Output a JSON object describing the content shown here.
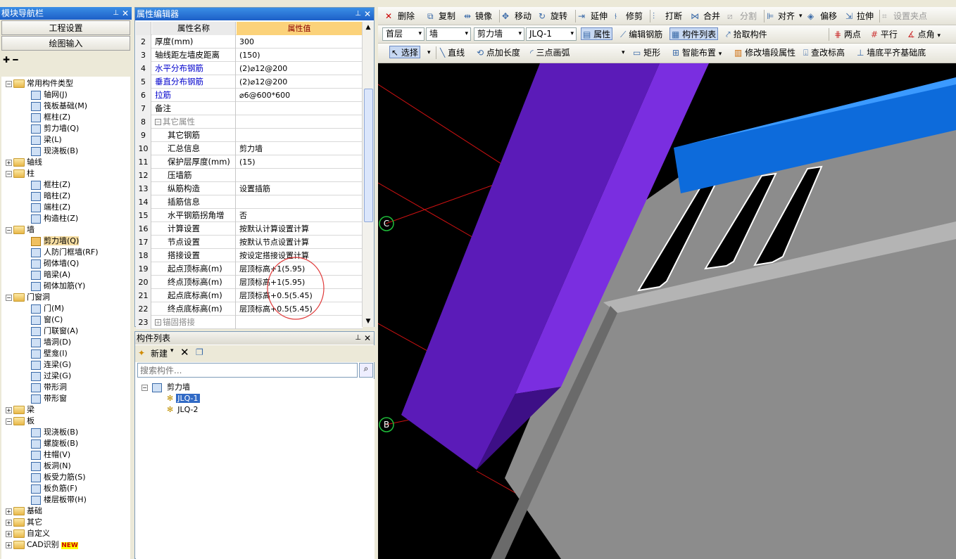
{
  "nav": {
    "title": "模块导航栏",
    "btn_project": "工程设置",
    "btn_draw": "绘图输入",
    "tools": "✚ ━",
    "tree": [
      {
        "lvl": 0,
        "exp": "-",
        "folder": true,
        "label": "常用构件类型"
      },
      {
        "lvl": 1,
        "label": "轴网(J)"
      },
      {
        "lvl": 1,
        "label": "筏板基础(M)"
      },
      {
        "lvl": 1,
        "label": "框柱(Z)"
      },
      {
        "lvl": 1,
        "label": "剪力墙(Q)"
      },
      {
        "lvl": 1,
        "label": "梁(L)"
      },
      {
        "lvl": 1,
        "label": "现浇板(B)"
      },
      {
        "lvl": 0,
        "exp": "+",
        "folder": true,
        "label": "轴线"
      },
      {
        "lvl": 0,
        "exp": "-",
        "folder": true,
        "label": "柱"
      },
      {
        "lvl": 1,
        "label": "框柱(Z)"
      },
      {
        "lvl": 1,
        "label": "暗柱(Z)"
      },
      {
        "lvl": 1,
        "label": "端柱(Z)"
      },
      {
        "lvl": 1,
        "label": "构造柱(Z)"
      },
      {
        "lvl": 0,
        "exp": "-",
        "folder": true,
        "label": "墙"
      },
      {
        "lvl": 1,
        "label": "剪力墙(Q)",
        "sel": true
      },
      {
        "lvl": 1,
        "label": "人防门框墙(RF)"
      },
      {
        "lvl": 1,
        "label": "砌体墙(Q)"
      },
      {
        "lvl": 1,
        "label": "暗梁(A)"
      },
      {
        "lvl": 1,
        "label": "砌体加筋(Y)"
      },
      {
        "lvl": 0,
        "exp": "-",
        "folder": true,
        "label": "门窗洞"
      },
      {
        "lvl": 1,
        "label": "门(M)"
      },
      {
        "lvl": 1,
        "label": "窗(C)"
      },
      {
        "lvl": 1,
        "label": "门联窗(A)"
      },
      {
        "lvl": 1,
        "label": "墙洞(D)"
      },
      {
        "lvl": 1,
        "label": "壁龛(I)"
      },
      {
        "lvl": 1,
        "label": "连梁(G)"
      },
      {
        "lvl": 1,
        "label": "过梁(G)"
      },
      {
        "lvl": 1,
        "label": "带形洞"
      },
      {
        "lvl": 1,
        "label": "带形窗"
      },
      {
        "lvl": 0,
        "exp": "+",
        "folder": true,
        "label": "梁"
      },
      {
        "lvl": 0,
        "exp": "-",
        "folder": true,
        "label": "板"
      },
      {
        "lvl": 1,
        "label": "现浇板(B)"
      },
      {
        "lvl": 1,
        "label": "螺旋板(B)"
      },
      {
        "lvl": 1,
        "label": "柱帽(V)"
      },
      {
        "lvl": 1,
        "label": "板洞(N)"
      },
      {
        "lvl": 1,
        "label": "板受力筋(S)"
      },
      {
        "lvl": 1,
        "label": "板负筋(F)"
      },
      {
        "lvl": 1,
        "label": "楼层板带(H)"
      },
      {
        "lvl": 0,
        "exp": "+",
        "folder": true,
        "label": "基础"
      },
      {
        "lvl": 0,
        "exp": "+",
        "folder": true,
        "label": "其它"
      },
      {
        "lvl": 0,
        "exp": "+",
        "folder": true,
        "label": "自定义"
      },
      {
        "lvl": 0,
        "exp": "+",
        "folder": true,
        "label": "CAD识别",
        "badge": "NEW"
      }
    ]
  },
  "prop": {
    "title": "属性编辑器",
    "col_name": "属性名称",
    "col_value": "属性值",
    "rows": [
      {
        "n": "2",
        "k": "厚度(mm)",
        "v": "300"
      },
      {
        "n": "3",
        "k": "轴线距左墙皮距离",
        "v": "(150)"
      },
      {
        "n": "4",
        "k": "水平分布钢筋",
        "v": "(2)⌀12@200",
        "blue": true
      },
      {
        "n": "5",
        "k": "垂直分布钢筋",
        "v": "(2)⌀12@200",
        "blue": true
      },
      {
        "n": "6",
        "k": "拉筋",
        "v": "⌀6@600*600",
        "blue": true
      },
      {
        "n": "7",
        "k": "备注",
        "v": ""
      },
      {
        "n": "8",
        "k": "其它属性",
        "v": "",
        "group": "-"
      },
      {
        "n": "9",
        "k": "其它钢筋",
        "v": "",
        "sub": true
      },
      {
        "n": "10",
        "k": "汇总信息",
        "v": "剪力墙",
        "sub": true
      },
      {
        "n": "11",
        "k": "保护层厚度(mm)",
        "v": "(15)",
        "sub": true
      },
      {
        "n": "12",
        "k": "压墙筋",
        "v": "",
        "sub": true
      },
      {
        "n": "13",
        "k": "纵筋构造",
        "v": "设置插筋",
        "sub": true
      },
      {
        "n": "14",
        "k": "插筋信息",
        "v": "",
        "sub": true
      },
      {
        "n": "15",
        "k": "水平钢筋拐角增",
        "v": "否",
        "sub": true
      },
      {
        "n": "16",
        "k": "计算设置",
        "v": "按默认计算设置计算",
        "sub": true
      },
      {
        "n": "17",
        "k": "节点设置",
        "v": "按默认节点设置计算",
        "sub": true
      },
      {
        "n": "18",
        "k": "搭接设置",
        "v": "按设定搭接设置计算",
        "sub": true
      },
      {
        "n": "19",
        "k": "起点顶标高(m)",
        "v": "层顶标高+1(5.95)",
        "sub": true
      },
      {
        "n": "20",
        "k": "终点顶标高(m)",
        "v": "层顶标高+1(5.95)",
        "sub": true
      },
      {
        "n": "21",
        "k": "起点底标高(m)",
        "v": "层顶标高+0.5(5.45)",
        "sub": true
      },
      {
        "n": "22",
        "k": "终点底标高(m)",
        "v": "层顶标高+0.5(5.45)",
        "sub": true
      },
      {
        "n": "23",
        "k": "锚固搭接",
        "v": "",
        "group": "+"
      }
    ]
  },
  "clist": {
    "title": "构件列表",
    "new_label": "新建",
    "search_placeholder": "搜索构件...",
    "root": "剪力墙",
    "items": [
      "JLQ-1",
      "JLQ-2"
    ],
    "selected": 0
  },
  "toolbar1": {
    "delete": "删除",
    "copy": "复制",
    "mirror": "镜像",
    "move": "移动",
    "rotate": "旋转",
    "extend": "延伸",
    "trim": "修剪",
    "break": "打断",
    "merge": "合并",
    "split": "分割",
    "align": "对齐",
    "offset": "偏移",
    "stretch": "拉伸",
    "grip": "设置夹点"
  },
  "toolbar2": {
    "floor": "首层",
    "category": "墙",
    "type": "剪力墙",
    "component": "JLQ-1",
    "property": "属性",
    "edit_rebar": "编辑钢筋",
    "comp_list": "构件列表",
    "pick": "拾取构件",
    "two_points": "两点",
    "parallel": "平行",
    "point_angle": "点角"
  },
  "toolbar3": {
    "select": "选择",
    "line": "直线",
    "point_length": "点加长度",
    "arc": "三点画弧",
    "rect": "矩形",
    "smart": "智能布置",
    "modify_seg": "修改墙段属性",
    "check_elev": "查改标高",
    "align_bottom": "墙底平齐基础底"
  },
  "view": {
    "axis_c": "C",
    "axis_b": "B",
    "colors": {
      "purple": "#5b1bb8",
      "blue_beam": "#0d6bdb",
      "wall": "#8c8c8c",
      "axis": "#cc1111"
    }
  }
}
